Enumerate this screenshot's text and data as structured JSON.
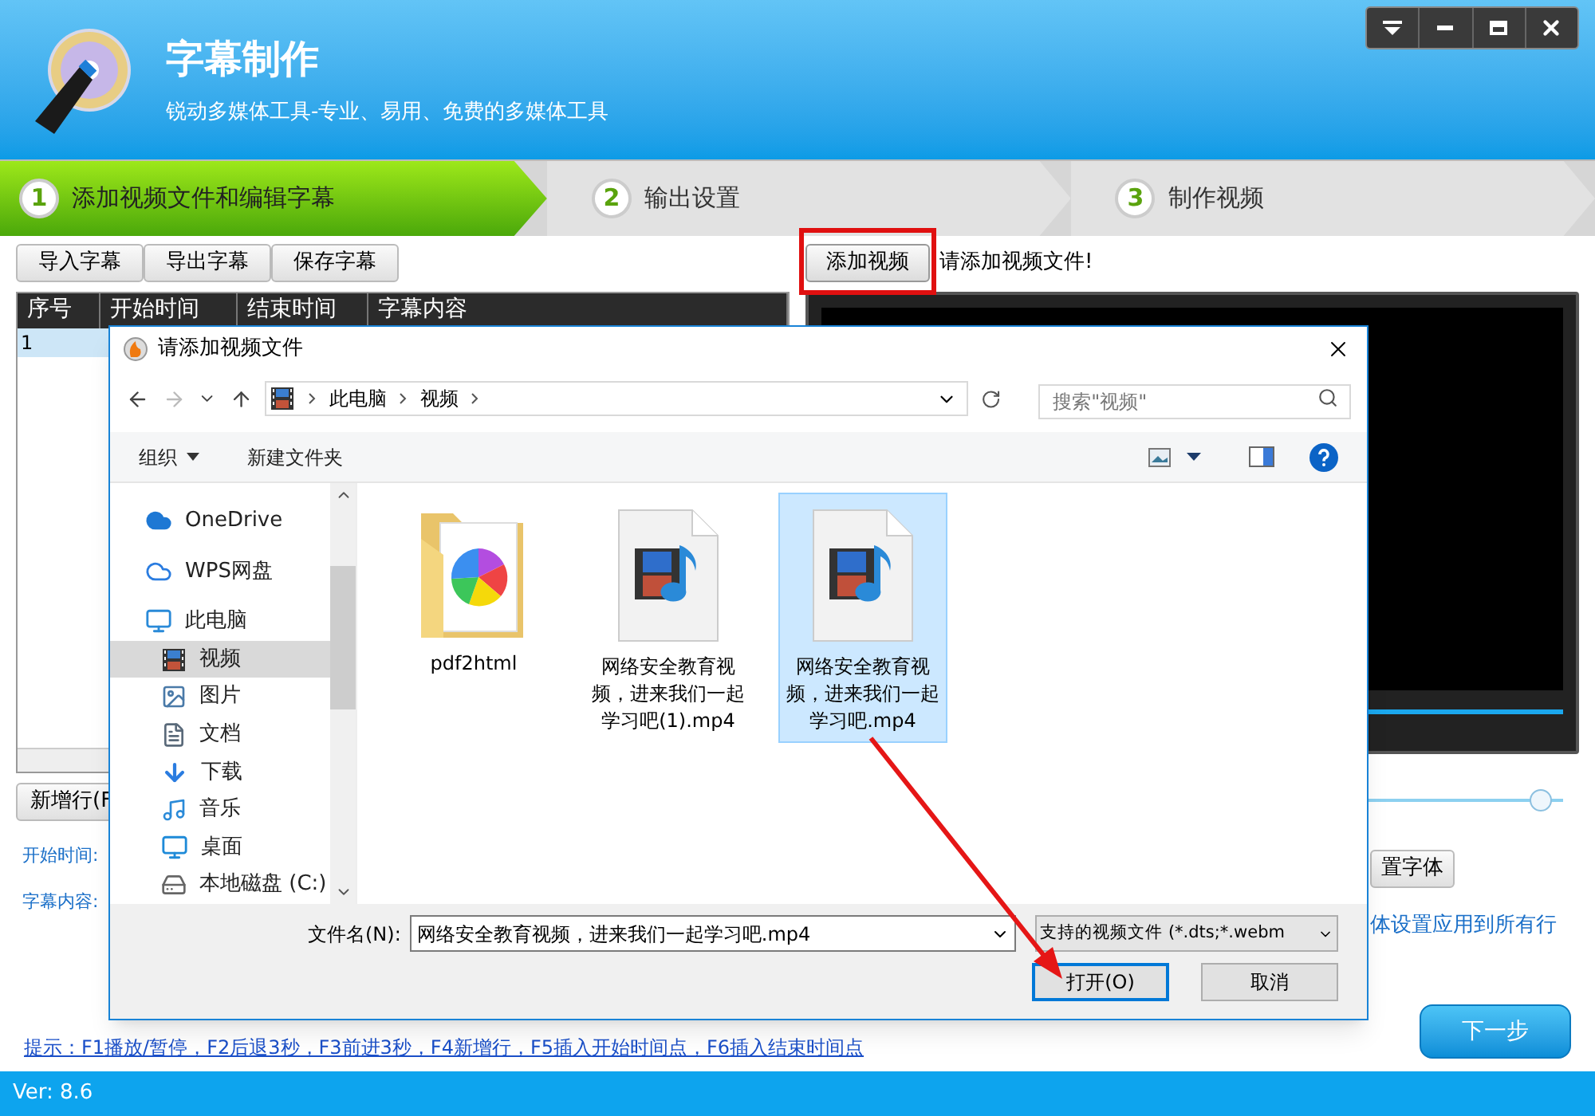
{
  "app": {
    "title": "字幕制作",
    "subtitle": "锐动多媒体工具-专业、易用、免费的多媒体工具"
  },
  "steps": [
    {
      "number": "1",
      "label": "添加视频文件和编辑字幕",
      "selected": true
    },
    {
      "number": "2",
      "label": "输出设置",
      "selected": false
    },
    {
      "number": "3",
      "label": "制作视频",
      "selected": false
    }
  ],
  "subtitle_toolbar": [
    "导入字幕",
    "导出字幕",
    "保存字幕"
  ],
  "table": {
    "columns": [
      "序号",
      "开始时间",
      "结束时间",
      "字幕内容"
    ],
    "rows": [
      {
        "cells": [
          "1"
        ],
        "selected": true
      }
    ]
  },
  "new_row_button": "新增行(F",
  "field_labels": [
    "开始时间:",
    "字幕内容:"
  ],
  "add_video_button": "添加视频",
  "add_video_hint": "请添加视频文件!",
  "volume_slider": {
    "level": 0.97
  },
  "font_button": "置字体",
  "apply_all_text": "体设置应用到所有行",
  "hint_link": "提示：F1播放/暂停，F2后退3秒，F3前进3秒，F4新增行，F5插入开始时间点，F6插入结束时间点",
  "next_button": "下一步",
  "status_bar": "Ver: 8.6",
  "dialog": {
    "title": "请添加视频文件",
    "breadcrumb": [
      "此电脑",
      "视频"
    ],
    "search": {
      "placeholder": "搜索\"视频\""
    },
    "toolbar": [
      "组织",
      "新建文件夹"
    ],
    "nav": [
      {
        "label": "OneDrive",
        "kind": "cloud",
        "selected": false
      },
      {
        "label": "WPS网盘",
        "kind": "wps",
        "selected": false
      },
      {
        "label": "此电脑",
        "kind": "computer",
        "selected": false,
        "children": [
          {
            "label": "视频",
            "kind": "video",
            "selected": true
          },
          {
            "label": "图片",
            "kind": "picture",
            "selected": false
          },
          {
            "label": "文档",
            "kind": "document",
            "selected": false
          },
          {
            "label": "下载",
            "kind": "download",
            "selected": false
          },
          {
            "label": "音乐",
            "kind": "music",
            "selected": false
          },
          {
            "label": "桌面",
            "kind": "desktop",
            "selected": false
          },
          {
            "label": "本地磁盘 (C:)",
            "kind": "drive",
            "selected": false
          }
        ]
      }
    ],
    "files": [
      {
        "name": "pdf2html",
        "kind": "folder",
        "selected": false
      },
      {
        "name": "网络安全教育视频，进来我们一起学习吧(1).mp4",
        "kind": "video",
        "selected": false
      },
      {
        "name": "网络安全教育视频，进来我们一起学习吧.mp4",
        "kind": "video",
        "selected": true
      }
    ],
    "filename_label": "文件名(N):",
    "filename": "网络安全教育视频，进来我们一起学习吧.mp4",
    "filter": "支持的视频文件 (*.dts;*.webm",
    "buttons": [
      "打开(O)",
      "取消"
    ]
  }
}
